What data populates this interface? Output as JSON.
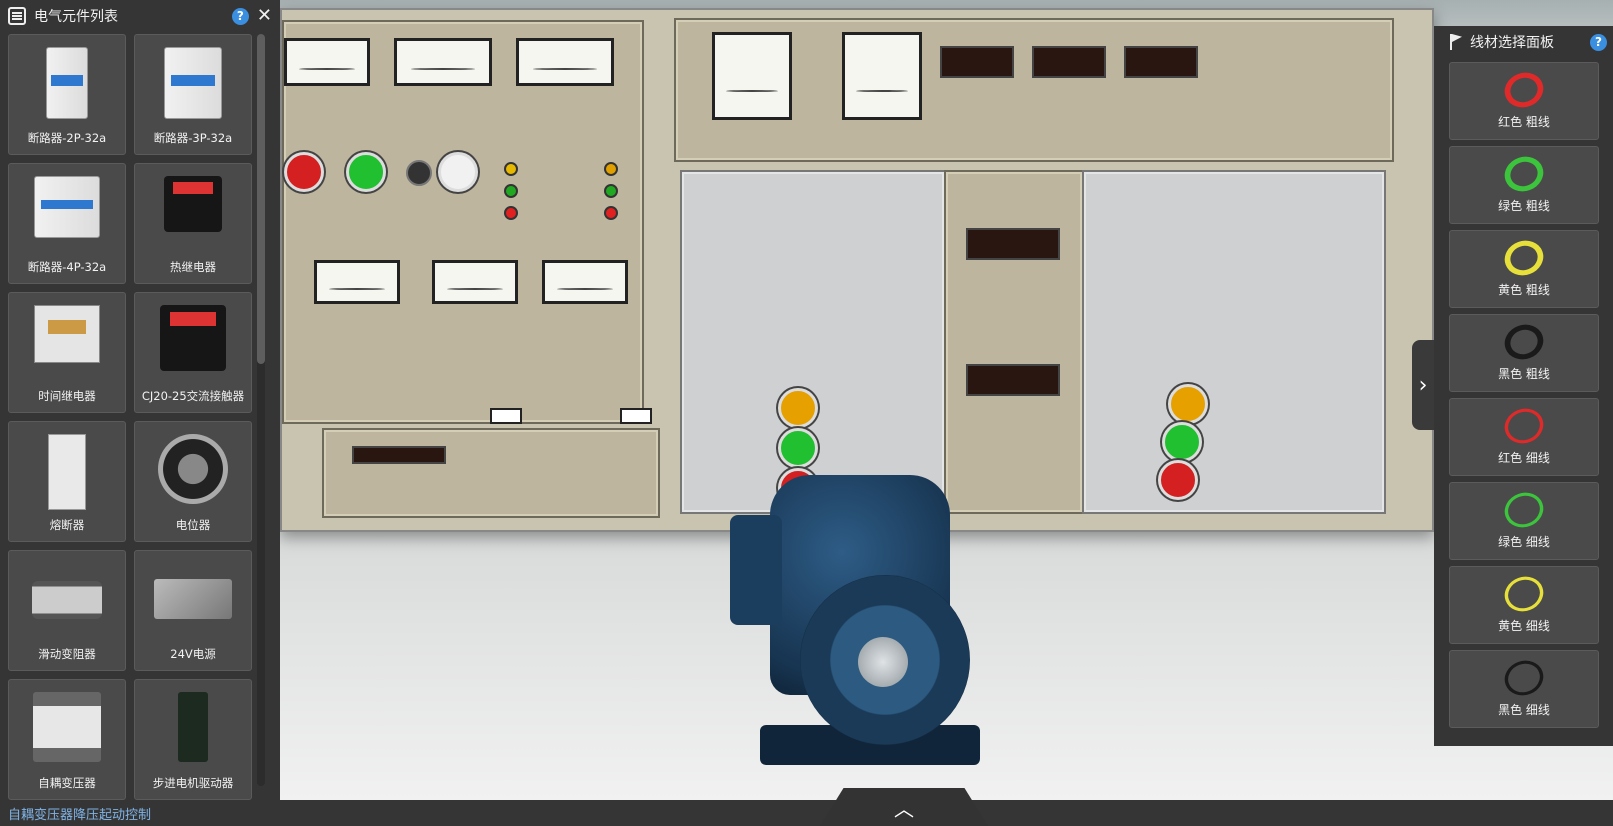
{
  "left_panel": {
    "title": "电气元件列表",
    "help_label": "?",
    "close_label": "✕",
    "icons": {
      "list": "list-icon",
      "help": "help-icon",
      "close": "close-icon"
    },
    "components": [
      {
        "label": "断路器-2P-32a",
        "icon": "breaker-2p"
      },
      {
        "label": "断路器-3P-32a",
        "icon": "breaker-3p"
      },
      {
        "label": "断路器-4P-32a",
        "icon": "breaker-4p"
      },
      {
        "label": "热继电器",
        "icon": "thermal-relay"
      },
      {
        "label": "时间继电器",
        "icon": "time-relay"
      },
      {
        "label": "CJ20-25交流接触器",
        "icon": "ac-contactor"
      },
      {
        "label": "熔断器",
        "icon": "fuse"
      },
      {
        "label": "电位器",
        "icon": "potentiometer"
      },
      {
        "label": "滑动变阻器",
        "icon": "rheostat"
      },
      {
        "label": "24V电源",
        "icon": "power-supply"
      },
      {
        "label": "自耦变压器",
        "icon": "autotransformer"
      },
      {
        "label": "步进电机驱动器",
        "icon": "stepper-driver"
      }
    ]
  },
  "right_panel": {
    "title": "线材选择面板",
    "help_label": "?",
    "collapse_label": "›",
    "icons": {
      "flag": "flag-icon",
      "help": "help-icon"
    },
    "wires": [
      {
        "label": "红色 粗线",
        "color": "#e02a2a",
        "thickness": "thick"
      },
      {
        "label": "绿色 粗线",
        "color": "#3cc43c",
        "thickness": "thick"
      },
      {
        "label": "黄色 粗线",
        "color": "#e8e03a",
        "thickness": "thick"
      },
      {
        "label": "黑色 粗线",
        "color": "#1a1a1a",
        "thickness": "thick"
      },
      {
        "label": "红色 细线",
        "color": "#e02a2a",
        "thickness": "thin"
      },
      {
        "label": "绿色 细线",
        "color": "#3cc43c",
        "thickness": "thin"
      },
      {
        "label": "黄色 细线",
        "color": "#e8e03a",
        "thickness": "thin"
      },
      {
        "label": "黑色 细线",
        "color": "#1a1a1a",
        "thickness": "thin"
      }
    ]
  },
  "bottom_bar": {
    "experiment_title": "自耦变压器降压起动控制",
    "expand_label": "︿"
  },
  "colors": {
    "panel_bg": "#353535",
    "card_bg": "#4a4a4a",
    "accent_blue": "#3b8fe0",
    "title_blue": "#7fb3e6"
  }
}
